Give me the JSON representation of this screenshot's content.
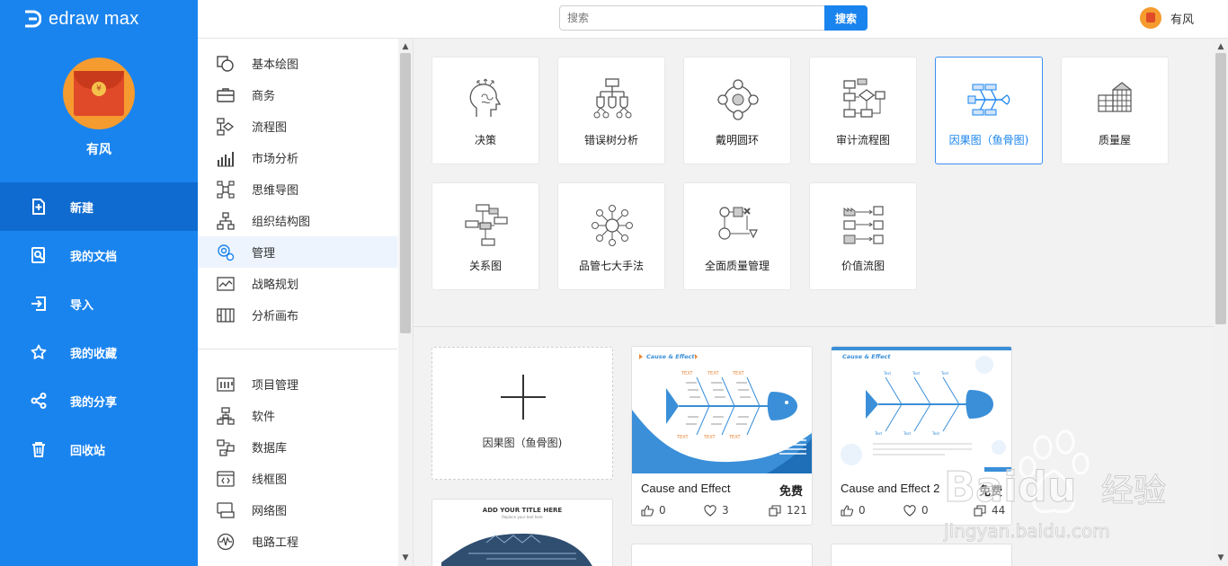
{
  "app": {
    "name": "edraw max"
  },
  "user": {
    "name": "有风"
  },
  "sidebar": {
    "items": [
      {
        "label": "新建",
        "icon": "new-doc-icon",
        "active": true
      },
      {
        "label": "我的文档",
        "icon": "my-docs-icon"
      },
      {
        "label": "导入",
        "icon": "import-icon"
      },
      {
        "label": "我的收藏",
        "icon": "star-icon"
      },
      {
        "label": "我的分享",
        "icon": "share-icon"
      },
      {
        "label": "回收站",
        "icon": "trash-icon"
      }
    ]
  },
  "search": {
    "placeholder": "搜索",
    "button": "搜索"
  },
  "categories": {
    "group1": [
      {
        "label": "基本绘图",
        "icon": "basic-shapes-icon"
      },
      {
        "label": "商务",
        "icon": "briefcase-icon"
      },
      {
        "label": "流程图",
        "icon": "flowchart-icon"
      },
      {
        "label": "市场分析",
        "icon": "bar-chart-icon"
      },
      {
        "label": "思维导图",
        "icon": "mindmap-icon"
      },
      {
        "label": "组织结构图",
        "icon": "org-chart-icon"
      },
      {
        "label": "管理",
        "icon": "management-icon",
        "active": true
      },
      {
        "label": "战略规划",
        "icon": "strategy-icon"
      },
      {
        "label": "分析画布",
        "icon": "canvas-icon"
      }
    ],
    "group2": [
      {
        "label": "项目管理",
        "icon": "gantt-icon"
      },
      {
        "label": "软件",
        "icon": "software-icon"
      },
      {
        "label": "数据库",
        "icon": "database-icon"
      },
      {
        "label": "线框图",
        "icon": "wireframe-icon"
      },
      {
        "label": "网络图",
        "icon": "network-icon"
      },
      {
        "label": "电路工程",
        "icon": "circuit-icon"
      }
    ]
  },
  "diagram_types": [
    {
      "label": "决策",
      "icon": "head-decision-icon"
    },
    {
      "label": "错误树分析",
      "icon": "fault-tree-icon"
    },
    {
      "label": "戴明圆环",
      "icon": "deming-cycle-icon"
    },
    {
      "label": "审计流程图",
      "icon": "audit-flow-icon"
    },
    {
      "label": "因果图（鱼骨图)",
      "icon": "fishbone-icon",
      "selected": true
    },
    {
      "label": "质量屋",
      "icon": "house-of-quality-icon"
    },
    {
      "label": "关系图",
      "icon": "relation-diagram-icon"
    },
    {
      "label": "品管七大手法",
      "icon": "seven-tools-icon"
    },
    {
      "label": "全面质量管理",
      "icon": "tqm-icon"
    },
    {
      "label": "价值流图",
      "icon": "value-stream-icon"
    }
  ],
  "new_card": {
    "label": "因果图（鱼骨图)"
  },
  "templates": [
    {
      "name": "Cause and Effect",
      "price": "免费",
      "likes": "0",
      "favorites": "3",
      "copies": "121",
      "thumb_title": "Cause & Effect"
    },
    {
      "name": "Cause and Effect 2",
      "price": "免费",
      "likes": "0",
      "favorites": "0",
      "copies": "44",
      "thumb_title": "Cause & Effect"
    }
  ],
  "partial_template": {
    "title": "ADD YOUR TITLE HERE",
    "subtitle": "Replace your text here"
  },
  "watermark": {
    "brand": "Baidu",
    "cn": "经验",
    "url": "jingyan.baidu.com"
  },
  "colors": {
    "accent": "#1a84ee",
    "sidebar_active": "#0f6bcf"
  }
}
